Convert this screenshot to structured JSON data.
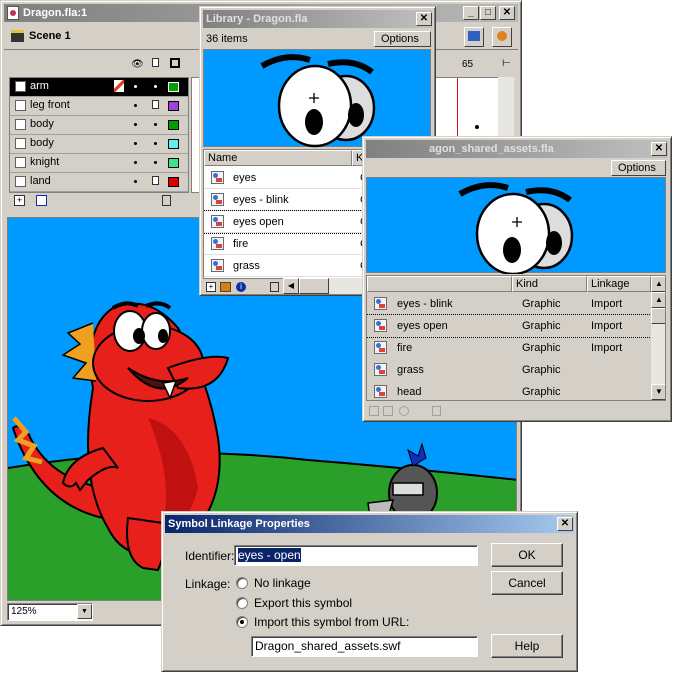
{
  "main_window": {
    "title": "Dragon.fla:1",
    "scene_label": "Scene 1",
    "zoom_value": "125%",
    "frame_number": "65",
    "layers": [
      {
        "name": "arm",
        "color": "#00a000",
        "selected": true,
        "locked": false
      },
      {
        "name": "leg front",
        "color": "#a040e0",
        "selected": false,
        "locked": true
      },
      {
        "name": "body",
        "color": "#00a000",
        "selected": false,
        "locked": false
      },
      {
        "name": "body",
        "color": "#60f0f0",
        "selected": false,
        "locked": false
      },
      {
        "name": "knight",
        "color": "#40e090",
        "selected": false,
        "locked": false
      },
      {
        "name": "land",
        "color": "#e00000",
        "selected": false,
        "locked": true
      }
    ]
  },
  "library_window": {
    "title": "Library - Dragon.fla",
    "item_count": "36 items",
    "options_label": "Options",
    "col_name": "Name",
    "col_kind": "Kind",
    "items": [
      {
        "name": "eyes",
        "kind": "Graphic"
      },
      {
        "name": "eyes - blink",
        "kind": "Graphic"
      },
      {
        "name": "eyes open",
        "kind": "Graphic",
        "focused": true
      },
      {
        "name": "fire",
        "kind": "Graphic"
      },
      {
        "name": "grass",
        "kind": "Graphic"
      }
    ]
  },
  "shared_library_window": {
    "title": "Library - Dragon_shared_assets.fla",
    "title_visible": "agon_shared_assets.fla",
    "options_label": "Options",
    "col_kind": "Kind",
    "col_linkage": "Linkage",
    "items": [
      {
        "name": "eyes - blink",
        "kind": "Graphic",
        "linkage": "Import"
      },
      {
        "name": "eyes open",
        "kind": "Graphic",
        "linkage": "Import"
      },
      {
        "name": "fire",
        "kind": "Graphic",
        "linkage": "Import"
      },
      {
        "name": "grass",
        "kind": "Graphic",
        "linkage": ""
      },
      {
        "name": "head",
        "kind": "Graphic",
        "linkage": ""
      }
    ]
  },
  "dialog": {
    "title": "Symbol Linkage Properties",
    "identifier_label": "Identifier:",
    "identifier_value": "eyes - open",
    "linkage_label": "Linkage:",
    "option_no_linkage": "No linkage",
    "option_export": "Export this symbol",
    "option_import": "Import this symbol from URL:",
    "url_value": "Dragon_shared_assets.swf",
    "ok_label": "OK",
    "cancel_label": "Cancel",
    "help_label": "Help"
  },
  "colors": {
    "titlebar_active": "#0a246a",
    "stage_sky": "#0099ff",
    "selection": "#0a246a"
  },
  "icons": [
    "fla-document-icon",
    "scene-clapper-icon",
    "eye-icon",
    "lock-icon",
    "outline-square-icon",
    "pencil-icon",
    "add-layer-icon",
    "add-folder-icon",
    "trash-icon",
    "graphic-symbol-icon",
    "new-symbol-icon",
    "new-folder-icon",
    "properties-icon",
    "close-icon",
    "minimize-icon",
    "maximize-icon",
    "edit-symbols-icon",
    "edit-scene-icon"
  ]
}
